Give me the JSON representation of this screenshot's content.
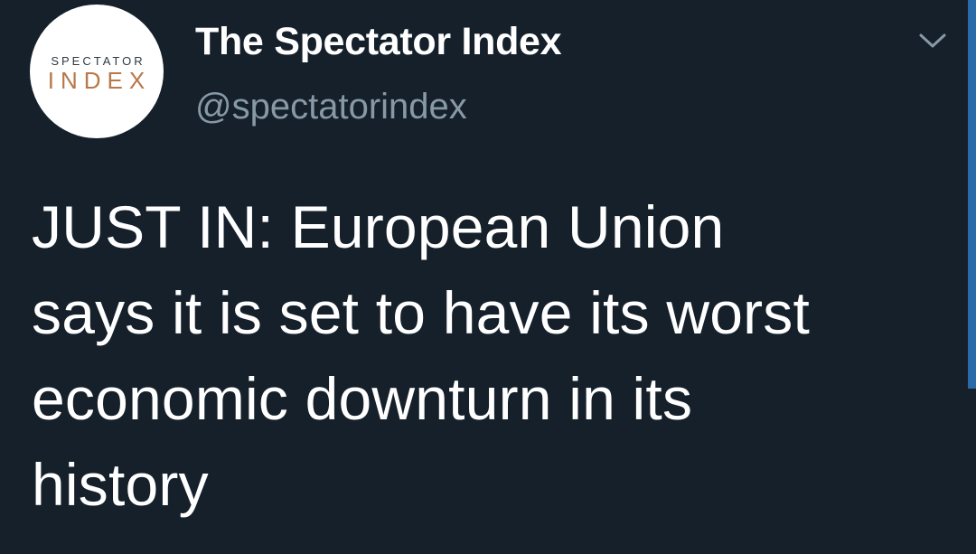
{
  "tweet": {
    "avatar": {
      "logo_line1": "SPECTATOR",
      "logo_line2": "INDEX"
    },
    "author": {
      "display_name": "The Spectator Index",
      "handle": "@spectatorindex"
    },
    "menu_icon": "chevron-down-icon",
    "text_lines": [
      "JUST IN: European Union",
      "says it is set to have its worst",
      "economic downturn in its",
      "history"
    ]
  },
  "colors": {
    "background": "#15202b",
    "text": "#ffffff",
    "secondary_text": "#8899a6",
    "logo_accent": "#b8784a",
    "scrollbar": "#2a6aa8"
  }
}
